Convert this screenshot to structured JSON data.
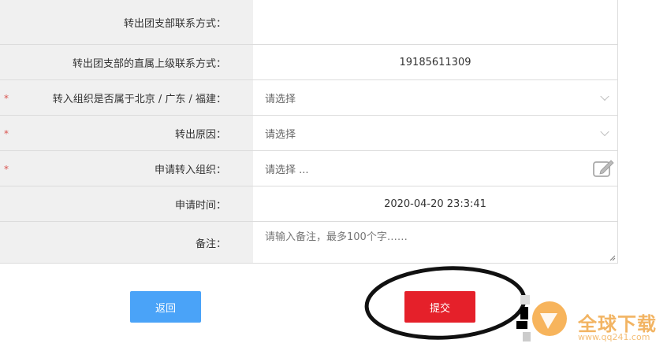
{
  "form": {
    "rows": [
      {
        "label": "转出团支部联系方式：",
        "value": ""
      },
      {
        "label": "转出团支部的直属上级联系方式：",
        "value": "19185611309"
      },
      {
        "label": "转入组织是否属于北京 / 广东 / 福建：",
        "value": "请选择",
        "required": "*"
      },
      {
        "label": "转出原因：",
        "value": "请选择",
        "required": "*"
      },
      {
        "label": "申请转入组织：",
        "value": "请选择 ...",
        "required": "*"
      },
      {
        "label": "申请时间：",
        "value": "2020-04-20 23:3:41"
      },
      {
        "label": "备注：",
        "placeholder": "请输入备注，最多100个字……"
      }
    ]
  },
  "actions": {
    "back_label": "返回",
    "submit_label": "提交"
  },
  "watermark": {
    "brand": "全球下载",
    "url": "www.qq241.com"
  },
  "colors": {
    "back_button": "#4aa3f8",
    "submit_button": "#e5202a",
    "required": "#d9534f"
  }
}
